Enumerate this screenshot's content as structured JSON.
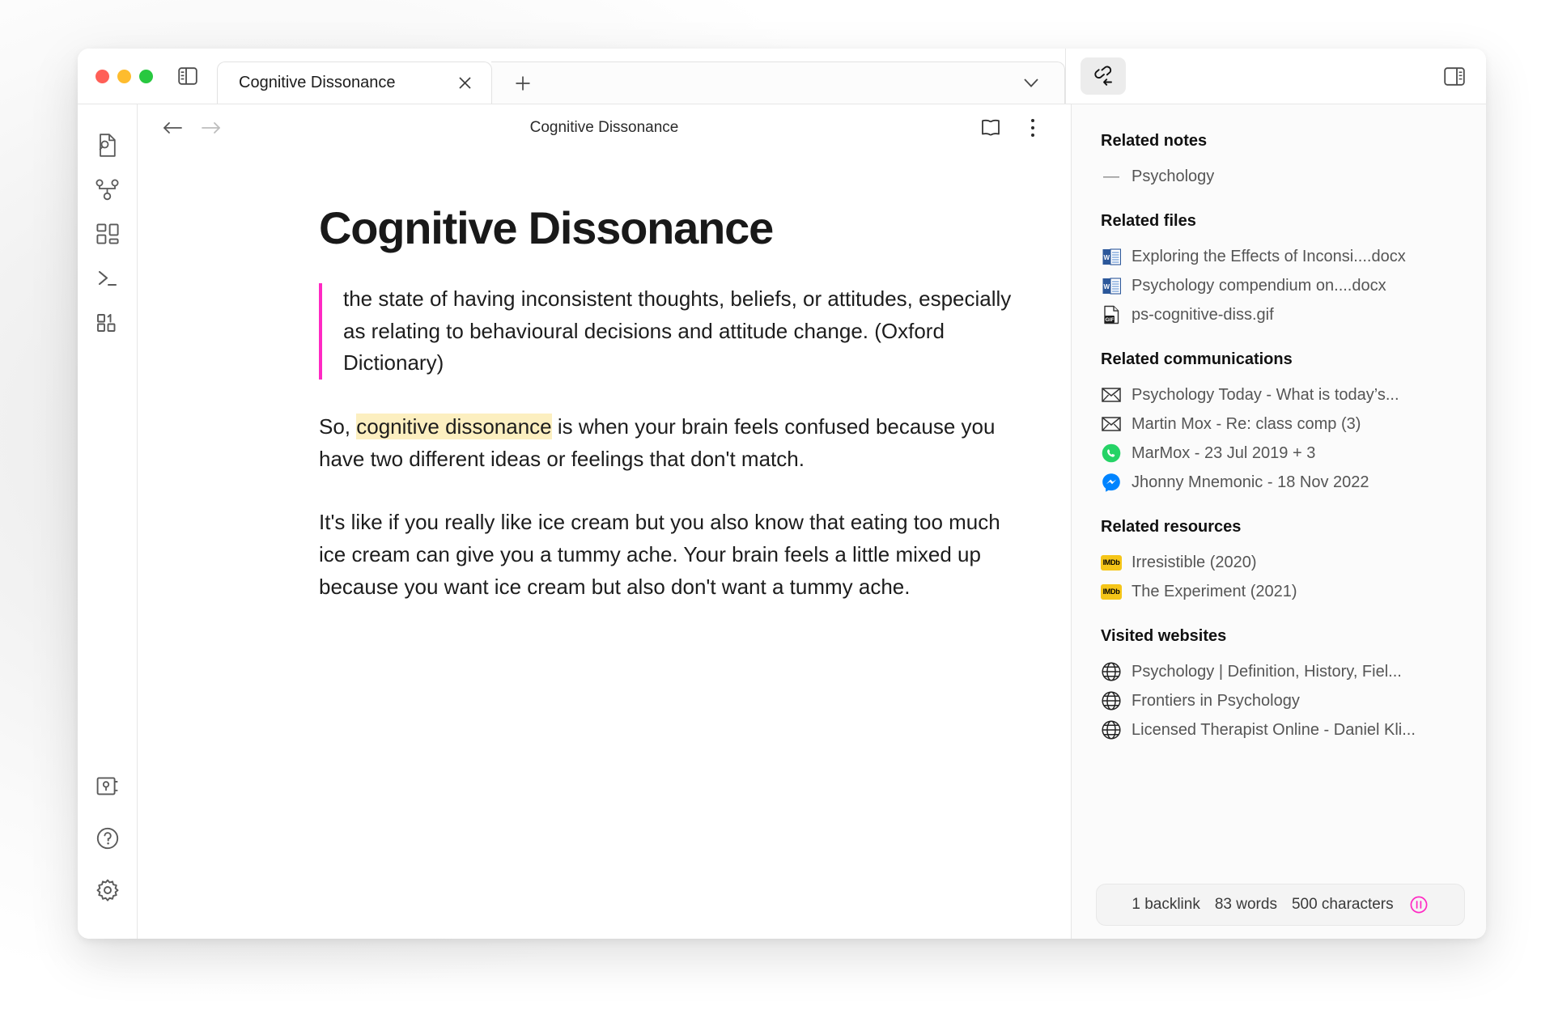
{
  "window": {
    "traffic_lights": [
      "close",
      "minimize",
      "maximize"
    ],
    "colors": {
      "red": "#ff5f57",
      "yellow": "#febc2e",
      "green": "#28c840",
      "quote_accent": "#ff29c3",
      "highlight": "#fcefc0",
      "imdb": "#f5c518",
      "pause_accent": "#ff29c3"
    }
  },
  "tabs": {
    "active": {
      "label": "Cognitive Dissonance",
      "close": "×"
    },
    "new_tab": "+",
    "chevron": "⌄"
  },
  "editor": {
    "doc_title": "Cognitive Dissonance",
    "note": {
      "heading": "Cognitive Dissonance",
      "quote": "the state of having inconsistent thoughts, beliefs, or attitudes, especially as relating to behavioural decisions and attitude change. (Oxford Dictionary)",
      "para2_pre": "So, ",
      "para2_highlight": "cognitive dissonance",
      "para2_post": " is when your brain feels confused because you have two different ideas or feelings that don't match.",
      "para3": "It's like if you really like ice cream but you also know that eating too much ice cream can give you a tummy ache. Your brain feels a little mixed up because you want ice cream but also don't want a tummy ache."
    }
  },
  "rail": {
    "top": [
      {
        "name": "file-search-icon"
      },
      {
        "name": "graph-icon"
      },
      {
        "name": "dashboard-icon"
      },
      {
        "name": "terminal-icon"
      },
      {
        "name": "binary-icon"
      }
    ],
    "bottom": [
      {
        "name": "vault-icon"
      },
      {
        "name": "help-icon"
      },
      {
        "name": "settings-icon"
      }
    ]
  },
  "right_panel": {
    "sections": [
      {
        "title": "Related notes",
        "items": [
          {
            "icon": "dash-icon",
            "label": "Psychology"
          }
        ]
      },
      {
        "title": "Related files",
        "items": [
          {
            "icon": "word-doc-icon",
            "label": "Exploring the Effects of Inconsi....docx"
          },
          {
            "icon": "word-doc-icon",
            "label": "Psychology compendium on....docx"
          },
          {
            "icon": "gif-file-icon",
            "label": "ps-cognitive-diss.gif"
          }
        ]
      },
      {
        "title": "Related communications",
        "items": [
          {
            "icon": "envelope-icon",
            "label": "Psychology Today - What is today’s..."
          },
          {
            "icon": "envelope-icon",
            "label": "Martin Mox - Re: class comp (3)"
          },
          {
            "icon": "whatsapp-icon",
            "label": "MarMox - 23 Jul 2019 + 3"
          },
          {
            "icon": "messenger-icon",
            "label": "Jhonny Mnemonic - 18 Nov 2022"
          }
        ]
      },
      {
        "title": "Related resources",
        "items": [
          {
            "icon": "imdb-icon",
            "label": "Irresistible (2020)"
          },
          {
            "icon": "imdb-icon",
            "label": "The Experiment (2021)"
          }
        ]
      },
      {
        "title": "Visited websites",
        "items": [
          {
            "icon": "globe-icon",
            "label": "Psychology | Definition, History, Fiel..."
          },
          {
            "icon": "globe-icon",
            "label": "Frontiers in Psychology"
          },
          {
            "icon": "globe-icon",
            "label": "Licensed Therapist Online - Daniel Kli..."
          }
        ]
      }
    ],
    "status_bar": {
      "backlinks": "1 backlink",
      "words": "83 words",
      "characters": "500 characters"
    }
  }
}
